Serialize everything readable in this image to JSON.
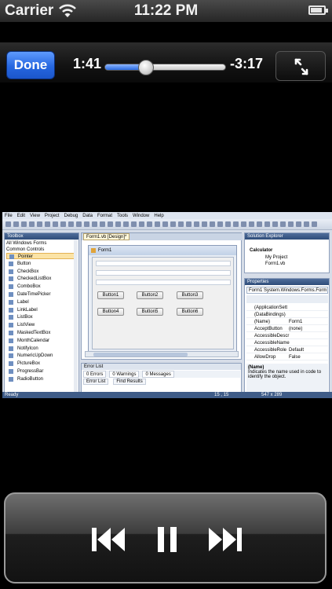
{
  "status_bar": {
    "carrier": "Carrier",
    "time": "11:22 PM",
    "battery_level": 0.85,
    "icons": [
      "wifi-icon",
      "battery-icon"
    ]
  },
  "player": {
    "done_label": "Done",
    "elapsed": "1:41",
    "remaining": "-3:17",
    "progress": 0.34,
    "icons": [
      "expand-icon",
      "previous-track-icon",
      "pause-icon",
      "next-track-icon"
    ]
  },
  "video": {
    "menu": [
      "File",
      "Edit",
      "View",
      "Project",
      "Debug",
      "Data",
      "Format",
      "Tools",
      "Window",
      "Help"
    ],
    "toolbox": {
      "title": "Toolbox",
      "groups": [
        "All Windows Forms",
        "Common Controls"
      ],
      "items": [
        "Pointer",
        "Button",
        "CheckBox",
        "CheckedListBox",
        "ComboBox",
        "DateTimePicker",
        "Label",
        "LinkLabel",
        "ListBox",
        "ListView",
        "MaskedTextBox",
        "MonthCalendar",
        "NotifyIcon",
        "NumericUpDown",
        "PictureBox",
        "ProgressBar",
        "RadioButton"
      ]
    },
    "designer": {
      "tab": "Form1.vb [Design]*",
      "form_title": "Form1",
      "buttons": [
        "Button1",
        "Button2",
        "Button3",
        "Button4",
        "Button5",
        "Button6"
      ]
    },
    "error_list": {
      "title": "Error List",
      "tabs": [
        "0 Errors",
        "0 Warnings",
        "0 Messages"
      ],
      "bottom_tabs": [
        "Error List",
        "Find Results"
      ]
    },
    "solution_explorer": {
      "title": "Solution Explorer",
      "items": [
        "Calculator",
        "My Project",
        "Form1.vb"
      ]
    },
    "properties": {
      "title": "Properties",
      "object": "Form1 System.Windows.Forms.Form",
      "rows": [
        {
          "name": "(ApplicationSett",
          "value": ""
        },
        {
          "name": "(DataBindings)",
          "value": ""
        },
        {
          "name": "(Name)",
          "value": "Form1"
        },
        {
          "name": "AcceptButton",
          "value": "(none)"
        },
        {
          "name": "AccessibleDescr",
          "value": ""
        },
        {
          "name": "AccessibleName",
          "value": ""
        },
        {
          "name": "AccessibleRole",
          "value": "Default"
        },
        {
          "name": "AllowDrop",
          "value": "False"
        }
      ],
      "desc_title": "(Name)",
      "desc_text": "Indicates the name used in code to identify the object."
    },
    "status": {
      "left": "Ready",
      "coords": "15 , 15",
      "size": "547 x 289"
    }
  }
}
